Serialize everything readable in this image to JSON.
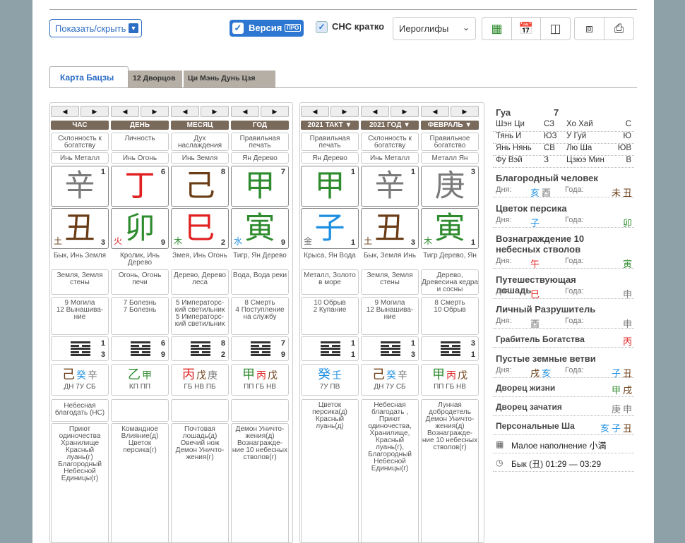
{
  "toolbar": {
    "show_hide": "Показать/скрыть",
    "version": "Версия",
    "pro": "ПРО",
    "cns": "СНС кратко",
    "script": "Иероглифы"
  },
  "tabs": [
    "Карта Бацзы",
    "12 Дворцов",
    "Ци Мэнь Дунь Цзя"
  ],
  "natal": [
    {
      "nav_left": "◀",
      "nav_right": "▶",
      "header": "ЧАС",
      "star": "Склонность к богатству",
      "stem_yy": "Инь Металл",
      "stem": "辛",
      "stem_color": "#7a7a7a",
      "stem_num": "1",
      "branch": "丑",
      "branch_color": "#6b3d16",
      "branch_el": "土",
      "branch_el_color": "#6b3d16",
      "branch_num": "3",
      "animal": "Бык, Инь Земля",
      "nayin": "Земля, Земля стены",
      "stage1": "9 Могила",
      "stage2": "12 Вынашива-ние",
      "hex_top": "1",
      "hex_bottom": "3",
      "hidden": [
        [
          "己",
          "#6b3d16"
        ],
        [
          "癸",
          "#1e8fe0"
        ],
        [
          "辛",
          "#7a7a7a"
        ]
      ],
      "hidden_gods": "ДН 7У СБ",
      "sha1": "Небесная благодать (НС)",
      "sha2": "Приют одиночества Хранилище Красный луань(г) Благородный Небесной Единицы(г)"
    },
    {
      "nav_left": "◀",
      "nav_right": "▶",
      "header": "ДЕНЬ",
      "star": "Личность",
      "stem_yy": "Инь Огонь",
      "stem": "丁",
      "stem_color": "#e02020",
      "stem_num": "6",
      "branch": "卯",
      "branch_color": "#2e8b2e",
      "branch_el": "火",
      "branch_el_color": "#e02020",
      "branch_num": "9",
      "animal": "Кролик, Инь Дерево",
      "nayin": "Огонь, Огонь печи",
      "stage1": "7 Болезнь",
      "stage2": "7 Болезнь",
      "hex_top": "6",
      "hex_bottom": "9",
      "hidden": [
        [
          "乙",
          "#2e8b2e"
        ],
        [
          "甲",
          "#2e8b2e"
        ]
      ],
      "hidden_gods": "КП ПП",
      "sha1": "",
      "sha2": "Командное Влияние(д) Цветок персика(г)"
    },
    {
      "nav_left": "◀",
      "nav_right": "▶",
      "header": "МЕСЯЦ",
      "star": "Дух наслаждения",
      "stem_yy": "Инь Земля",
      "stem": "己",
      "stem_color": "#6b3d16",
      "stem_num": "8",
      "branch": "巳",
      "branch_color": "#e02020",
      "branch_el": "木",
      "branch_el_color": "#2e8b2e",
      "branch_num": "2",
      "animal": "Змея, Инь Огонь",
      "nayin": "Дерево, Дерево леса",
      "stage1": "5 Императорс-кий светильник",
      "stage2": "5 Императорс-кий светильник",
      "hex_top": "8",
      "hex_bottom": "2",
      "hidden": [
        [
          "丙",
          "#e02020"
        ],
        [
          "戊",
          "#6b3d16"
        ],
        [
          "庚",
          "#7a7a7a"
        ]
      ],
      "hidden_gods": "ГБ НВ ПБ",
      "sha1": "",
      "sha2": "Почтовая лошадь(д) Овечий нож Демон Уничто-жения(г)"
    },
    {
      "nav_left": "◀",
      "nav_right": "▶",
      "header": "ГОД",
      "star": "Правильная печать",
      "stem_yy": "Ян Дерево",
      "stem": "甲",
      "stem_color": "#2e8b2e",
      "stem_num": "7",
      "branch": "寅",
      "branch_color": "#2e8b2e",
      "branch_el": "水",
      "branch_el_color": "#1e8fe0",
      "branch_num": "9",
      "animal": "Тигр, Ян Дерево",
      "nayin": "Вода, Вода реки",
      "stage1": "8 Смерть",
      "stage2": "4 Поступление на службу",
      "hex_top": "7",
      "hex_bottom": "9",
      "hidden": [
        [
          "甲",
          "#2e8b2e"
        ],
        [
          "丙",
          "#e02020"
        ],
        [
          "戊",
          "#6b3d16"
        ]
      ],
      "hidden_gods": "ПП ГБ НВ",
      "sha1": "",
      "sha2": "Демон Уничто-жения(д) Вознагражде-ние 10 небесных стволов(г)"
    }
  ],
  "luck": [
    {
      "nav_left": "◀",
      "nav_right": "▶",
      "header": "2021 ТАКТ ▼",
      "star": "Правильная печать",
      "stem_yy": "Ян Дерево",
      "stem": "甲",
      "stem_color": "#2e8b2e",
      "stem_num": "1",
      "branch": "子",
      "branch_color": "#1e8fe0",
      "branch_el": "金",
      "branch_el_color": "#7a7a7a",
      "branch_num": "1",
      "animal": "Крыса, Ян Вода",
      "nayin": "Металл, Золото в море",
      "stage1": "10 Обрыв",
      "stage2": "2 Купание",
      "hex_top": "1",
      "hex_bottom": "1",
      "hidden": [
        [
          "癸",
          "#1e8fe0"
        ],
        [
          "壬",
          "#1e8fe0"
        ]
      ],
      "hidden_gods": "7У ПВ",
      "sha1": "Цветок персика(д) Красный луань(д)",
      "sha2": ""
    },
    {
      "nav_left": "◀",
      "nav_right": "▶",
      "header": "2021 ГОД ▼",
      "star": "Склонность к богатству",
      "stem_yy": "Инь Металл",
      "stem": "辛",
      "stem_color": "#7a7a7a",
      "stem_num": "1",
      "branch": "丑",
      "branch_color": "#6b3d16",
      "branch_el": "土",
      "branch_el_color": "#6b3d16",
      "branch_num": "3",
      "animal": "Бык, Земля Инь",
      "nayin": "Земля, Земля стены",
      "stage1": "9 Могила",
      "stage2": "12 Вынашива-ние",
      "hex_top": "1",
      "hex_bottom": "3",
      "hidden": [
        [
          "己",
          "#6b3d16"
        ],
        [
          "癸",
          "#1e8fe0"
        ],
        [
          "辛",
          "#7a7a7a"
        ]
      ],
      "hidden_gods": "ДН 7У СБ",
      "sha1": "Небесная благодать , Приют одиночества, Хранилище, Красный луань(г), Благородный Небесной Единицы(г)",
      "sha2": ""
    },
    {
      "nav_left": "◀",
      "nav_right": "▶",
      "header": "ФЕВРАЛЬ ▼",
      "star": "Правильное богатство",
      "stem_yy": "Металл Ян",
      "stem": "庚",
      "stem_color": "#7a7a7a",
      "stem_num": "3",
      "branch": "寅",
      "branch_color": "#2e8b2e",
      "branch_el": "木",
      "branch_el_color": "#2e8b2e",
      "branch_num": "1",
      "animal": "Тигр Дерево, Ян",
      "nayin": "Дерево, Древесина кедра и сосны",
      "stage1": "8 Смерть",
      "stage2": "10 Обрыв",
      "hex_top": "3",
      "hex_bottom": "1",
      "hidden": [
        [
          "甲",
          "#2e8b2e"
        ],
        [
          "丙",
          "#e02020"
        ],
        [
          "戊",
          "#6b3d16"
        ]
      ],
      "hidden_gods": "ПП ГБ НВ",
      "sha1": "Лунная добродетель Демон Уничто-жения(д) Вознагражде-ние 10 небесных стволов(г)",
      "sha2": ""
    }
  ],
  "side": {
    "gua_label": "Гуа",
    "gua_value": "7",
    "dirs": [
      [
        "Шэн Ци",
        "СЗ",
        "Хо Хай",
        "С"
      ],
      [
        "Тянь И",
        "ЮЗ",
        "У Гуй",
        "Ю"
      ],
      [
        "Янь Нянь",
        "СВ",
        "Лю Ша",
        "ЮВ"
      ],
      [
        "Фу Вэй",
        "З",
        "Цзюэ Мин",
        "В"
      ]
    ],
    "sections": [
      {
        "title": "Благородный человек",
        "day_label": "Дня:",
        "day": [
          [
            "亥",
            "#1e8fe0"
          ],
          [
            "酉",
            "#7a7a7a"
          ]
        ],
        "year_label": "Года:",
        "year": [
          [
            "未",
            "#6b3d16"
          ],
          [
            "丑",
            "#6b3d16"
          ]
        ]
      },
      {
        "title": "Цветок персика",
        "day_label": "Дня:",
        "day": [
          [
            "子",
            "#1e8fe0"
          ]
        ],
        "year_label": "Года:",
        "year": [
          [
            "卯",
            "#2e8b2e"
          ]
        ]
      },
      {
        "title": "Вознаграждение 10 небесных стволов",
        "day_label": "Дня:",
        "day": [
          [
            "午",
            "#e02020"
          ]
        ],
        "year_label": "Года:",
        "year": [
          [
            "寅",
            "#2e8b2e"
          ]
        ]
      },
      {
        "title": "Путешествующая лошадь",
        "day_label": "Дня:",
        "day": [
          [
            "巳",
            "#e02020"
          ]
        ],
        "year_label": "Года:",
        "year": [
          [
            "申",
            "#7a7a7a"
          ]
        ]
      },
      {
        "title": "Личный Разрушитель",
        "day_label": "Дня:",
        "day": [
          [
            "酉",
            "#7a7a7a"
          ]
        ],
        "year_label": "Года:",
        "year": [
          [
            "申",
            "#7a7a7a"
          ]
        ]
      }
    ],
    "thief_label": "Грабитель Богатства",
    "thief": [
      [
        "丙",
        "#e02020"
      ]
    ],
    "empty_title": "Пустые земные ветви",
    "empty_day": [
      [
        "戌",
        "#6b3d16"
      ],
      [
        "亥",
        "#1e8fe0"
      ]
    ],
    "empty_year": [
      [
        "子",
        "#1e8fe0"
      ],
      [
        "丑",
        "#6b3d16"
      ]
    ],
    "life_label": "Дворец жизни",
    "life": [
      [
        "甲",
        "#2e8b2e"
      ],
      [
        "戌",
        "#6b3d16"
      ]
    ],
    "conc_label": "Дворец зачатия",
    "conc": [
      [
        "庚",
        "#7a7a7a"
      ],
      [
        "申",
        "#7a7a7a"
      ]
    ],
    "sha_label": "Персональные Ша",
    "sha": [
      [
        "亥",
        "#1e8fe0"
      ],
      [
        "子",
        "#1e8fe0"
      ],
      [
        "丑",
        "#6b3d16"
      ]
    ],
    "term": "Малое наполнение 小満",
    "hour": "Бык (丑) 01:29 — 03:29"
  }
}
